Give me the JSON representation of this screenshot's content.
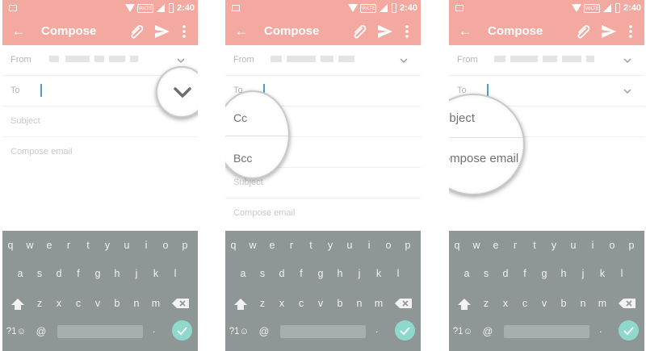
{
  "status_bar": {
    "volte": "VoLTE",
    "time": "2:40"
  },
  "app_bar": {
    "title": "Compose"
  },
  "compose": {
    "from_label": "From",
    "to_label": "To",
    "subject_placeholder": "Subject",
    "body_placeholder": "Compose email",
    "cc_label": "Cc",
    "bcc_label": "Bcc"
  },
  "keyboard": {
    "row1": [
      "q",
      "w",
      "e",
      "r",
      "t",
      "y",
      "u",
      "i",
      "o",
      "p"
    ],
    "row2": [
      "a",
      "s",
      "d",
      "f",
      "g",
      "h",
      "j",
      "k",
      "l"
    ],
    "row3": [
      "z",
      "x",
      "c",
      "v",
      "b",
      "n",
      "m"
    ],
    "symbols_label": "?1☺",
    "at_label": "@",
    "period_label": "."
  },
  "colors": {
    "accent": "#f3a9a0",
    "keyboard_bg": "#8e9796",
    "enter_key": "#8fd8cc",
    "cursor": "#4f9ad6"
  },
  "icons": [
    "image-icon",
    "wifi-icon",
    "signal-icon",
    "battery-icon",
    "back-arrow-icon",
    "attach-icon",
    "send-icon",
    "more-vert-icon",
    "chevron-down-icon",
    "shift-icon",
    "backspace-icon",
    "check-icon"
  ]
}
